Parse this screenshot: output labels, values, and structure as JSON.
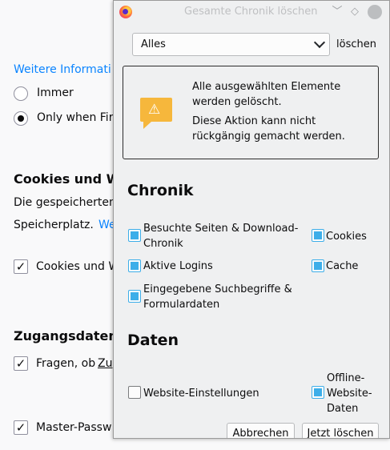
{
  "background": {
    "link_more": "Weitere Informati",
    "radio_always": "Immer",
    "radio_only_when": "Only when Fir",
    "cookies_heading": "Cookies und W",
    "desc_line1": "Die gespeicherten",
    "desc_line2": "Speicherplatz.",
    "desc_link": "We",
    "check_cookies": "Cookies und W",
    "logins_heading": "Zugangsdaten",
    "check_ask": "Fragen, ob",
    "check_ask_link": "Zu",
    "check_master": "Master-Passw"
  },
  "dialog": {
    "title": "Gesamte Chronik löschen",
    "range_value": "Alles",
    "range_label": "löschen",
    "warning_line1": "Alle ausgewählten Elemente",
    "warning_line2": "werden gelöscht.",
    "warning_line3": "Diese Aktion kann nicht",
    "warning_line4": "rückgängig gemacht werden.",
    "history_heading": "Chronik",
    "history_items": {
      "visited_l1": "Besuchte Seiten & Download-",
      "visited_l2": "Chronik",
      "cookies": "Cookies",
      "logins": "Aktive Logins",
      "cache": "Cache",
      "search_l1": "Eingegebene Suchbegriffe &",
      "search_l2": "Formulardaten"
    },
    "data_heading": "Daten",
    "data_items": {
      "site_settings": "Website-Einstellungen",
      "offline_l1": "Offline-",
      "offline_l2": "Website-",
      "offline_l3": "Daten"
    },
    "cancel_label": "Abbrechen",
    "clear_label": "Jetzt löschen"
  },
  "colors": {
    "accent": "#3daee9",
    "link": "#0a84ff",
    "warning": "#f6b73c"
  }
}
